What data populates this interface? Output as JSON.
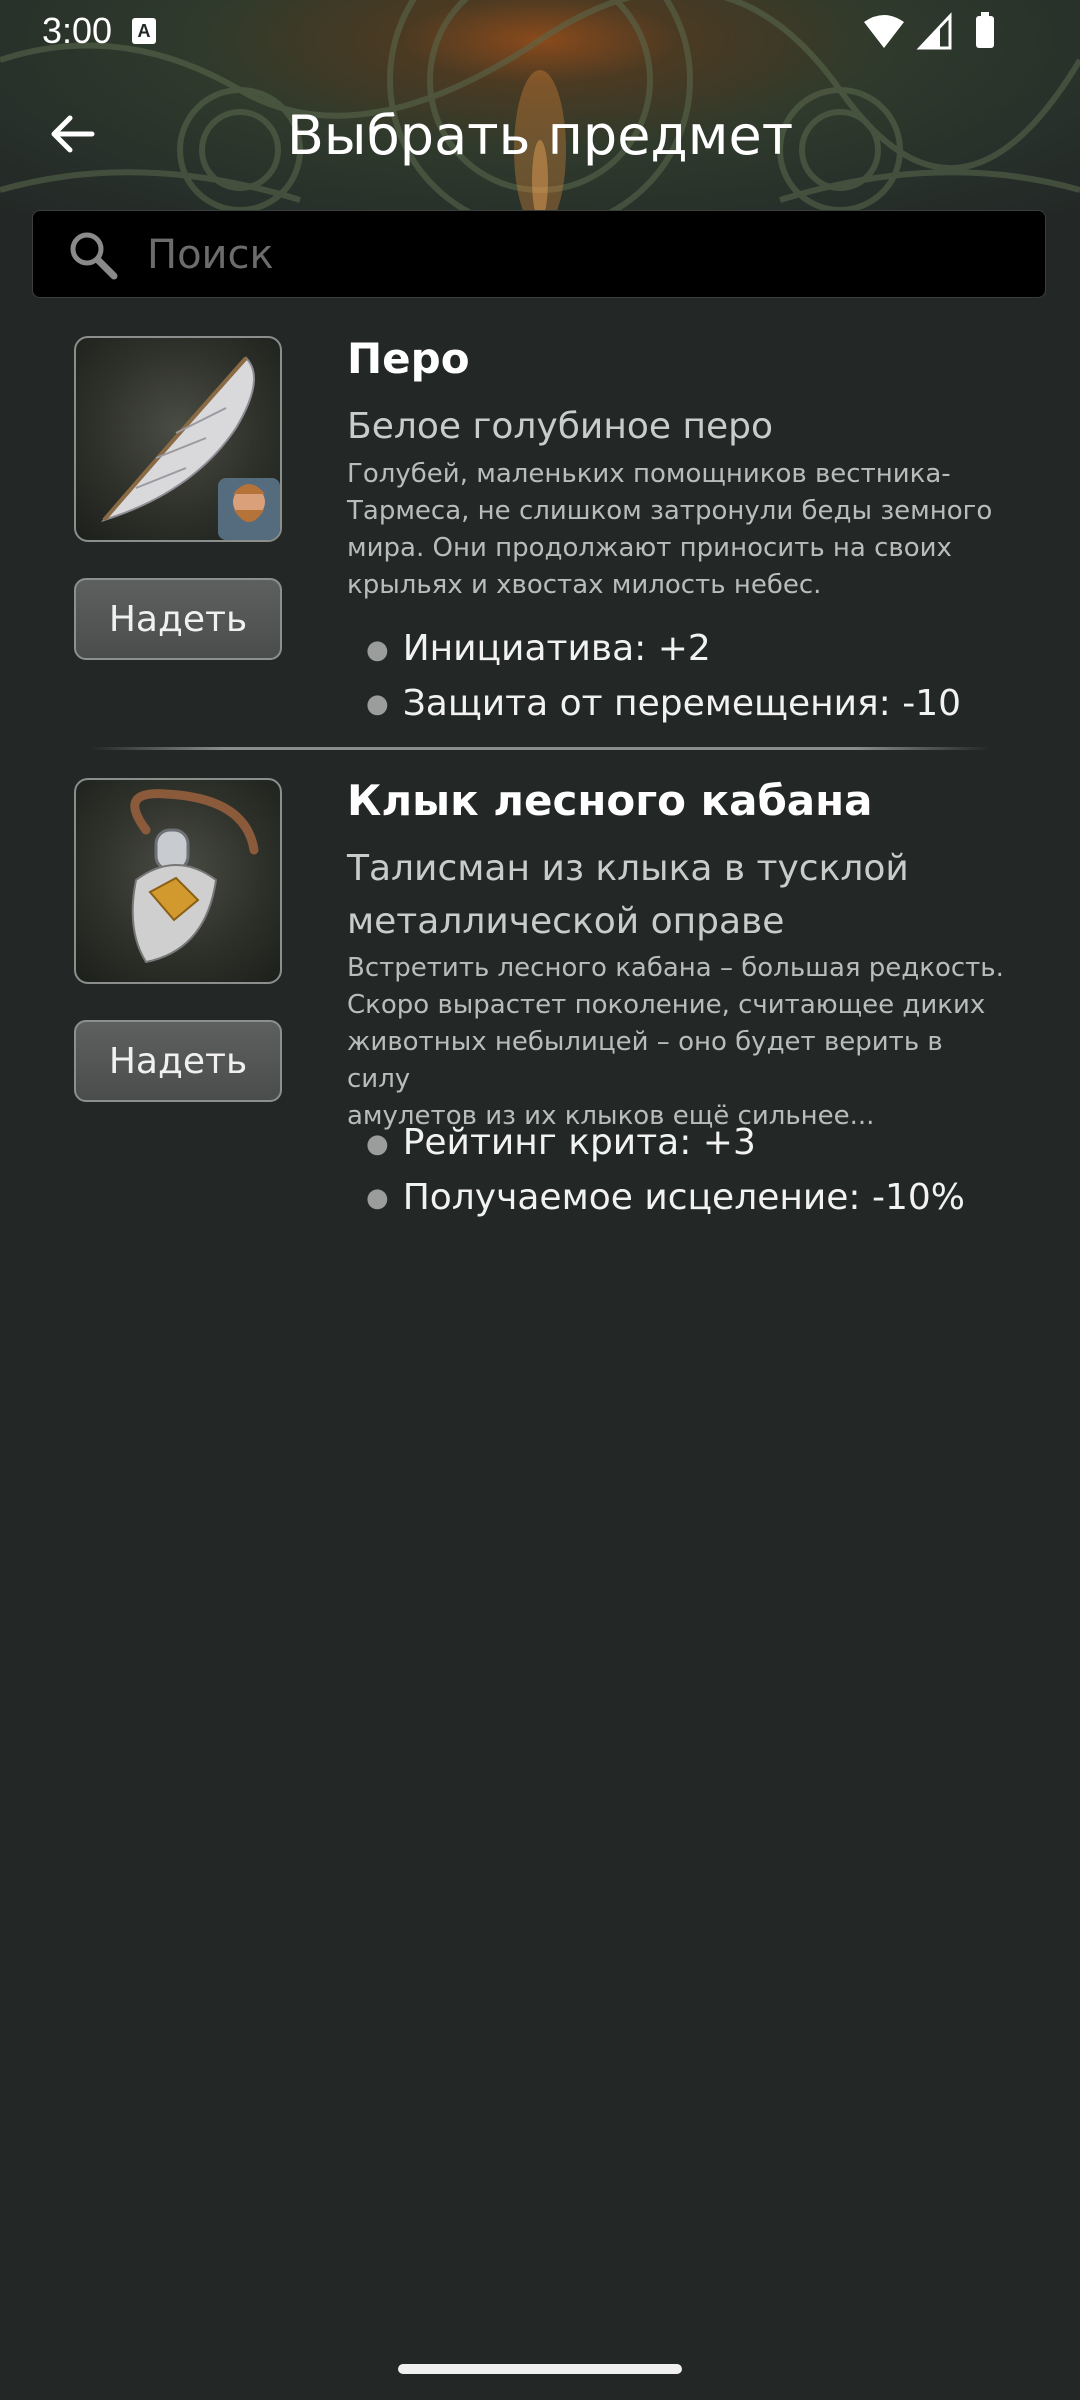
{
  "status_bar": {
    "time": "3:00",
    "notification_icon": "A",
    "icons": [
      "wifi-icon",
      "cell-signal-icon",
      "battery-icon"
    ]
  },
  "app_bar": {
    "title": "Выбрать предмет",
    "back_icon": "arrow-left-icon"
  },
  "search": {
    "placeholder": "Поиск",
    "value": "",
    "icon": "search-icon"
  },
  "items": [
    {
      "title": "Перо",
      "subtitle": "Белое голубиное перо",
      "description_lines": [
        "Голубей, маленьких помощников вестника-",
        "Тармеса, не слишком затронули беды земного",
        "мира. Они продолжают приносить на своих",
        "крыльях и хвостах милость небес."
      ],
      "stats": [
        "Инициатива: +2",
        "Защита от перемещения: -10"
      ],
      "button_label": "Надеть",
      "image": "feather-icon"
    },
    {
      "title": "Клык лесного кабана",
      "subtitle_lines": [
        "Талисман из клыка в тусклой",
        "металлической оправе"
      ],
      "description_lines": [
        "Встретить лесного кабана – большая редкость.",
        "Скоро вырастет поколение, считающее диких",
        "животных небылицей – оно будет верить в силу",
        "амулетов из их клыков ещё сильнее..."
      ],
      "stats": [
        "Рейтинг крита: +3",
        "Получаемое исцеление: -10%"
      ],
      "button_label": "Надеть",
      "image": "boar-tusk-icon"
    }
  ],
  "colors": {
    "background": "#232826",
    "search_background": "#000000",
    "button_background": "#565958"
  }
}
